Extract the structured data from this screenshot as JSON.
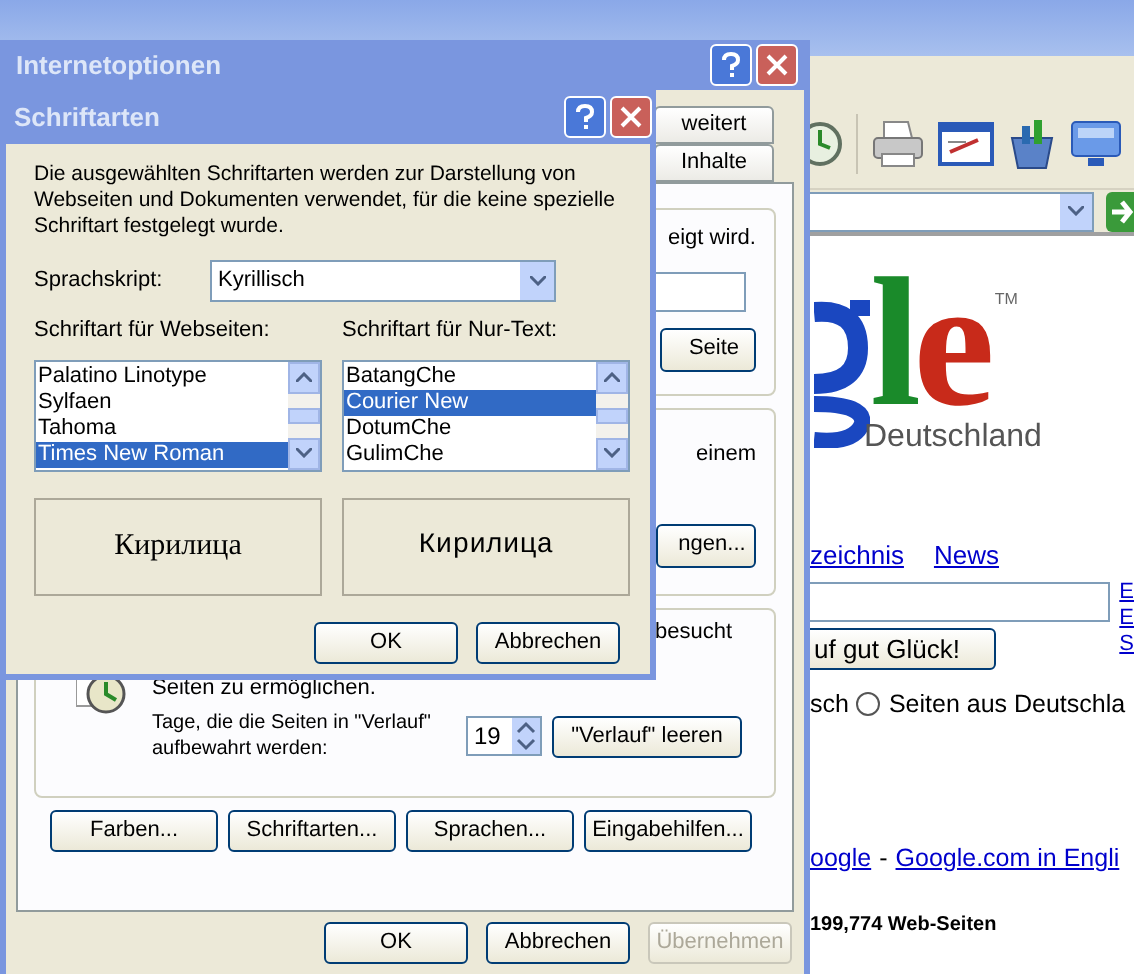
{
  "browser": {
    "logo": {
      "letters": "le",
      "trademark": "TM",
      "subtitle": "Deutschland"
    },
    "links": [
      "zeichnis",
      "News"
    ],
    "side_links": [
      "E",
      "E",
      "S"
    ],
    "lucky_button": "uf gut Glück!",
    "radio_prefix": "sch",
    "radio_option": {
      "label": "Seiten aus Deutschla",
      "selected": false
    },
    "footer": {
      "link_1": "oogle",
      "separator": "-",
      "link_2": "Google.com in Engli"
    },
    "result_count": "199,774 Web-Seiten"
  },
  "options_window": {
    "title": "Internetoptionen",
    "tabs": [
      {
        "label": "weitert",
        "selected": false
      },
      {
        "label": "Inhalte",
        "selected": false
      }
    ],
    "homepage_group": {
      "text": "eigt wird.",
      "button": "Seite"
    },
    "temp_files_group": {
      "text": "einem",
      "button": "ngen..."
    },
    "history_group": {
      "line_1": "besucht",
      "line_3": "Seiten zu ermöglichen.",
      "days_label": "Tage, die die Seiten in \"Verlauf\" aufbewahrt werden:",
      "days_value": "19",
      "clear_button": "\"Verlauf\" leeren"
    },
    "panel_buttons": [
      "Farben...",
      "Schriftarten...",
      "Sprachen...",
      "Eingabehilfen..."
    ],
    "dialog_buttons": [
      {
        "label": "OK",
        "disabled": false
      },
      {
        "label": "Abbrechen",
        "disabled": false
      },
      {
        "label": "Übernehmen",
        "disabled": true
      }
    ]
  },
  "fonts_dialog": {
    "title": "Schriftarten",
    "description": "Die ausgewählten Schriftarten werden zur Darstellung von Webseiten und Dokumenten verwendet, für die keine spezielle Schriftart festgelegt wurde.",
    "script_label": "Sprachskript:",
    "script_value": "Kyrillisch",
    "web_label": "Schriftart für Webseiten:",
    "web_fonts": [
      {
        "name": "Palatino Linotype",
        "selected": false
      },
      {
        "name": "Sylfaen",
        "selected": false
      },
      {
        "name": "Tahoma",
        "selected": false
      },
      {
        "name": "Times New Roman",
        "selected": true
      }
    ],
    "text_label": "Schriftart für Nur-Text:",
    "text_fonts": [
      {
        "name": "BatangChe",
        "selected": false
      },
      {
        "name": "Courier New",
        "selected": true
      },
      {
        "name": "DotumChe",
        "selected": false
      },
      {
        "name": "GulimChe",
        "selected": false
      }
    ],
    "web_preview": "Кирилица",
    "text_preview": "Кирилица",
    "buttons": [
      "OK",
      "Abbrechen"
    ]
  }
}
